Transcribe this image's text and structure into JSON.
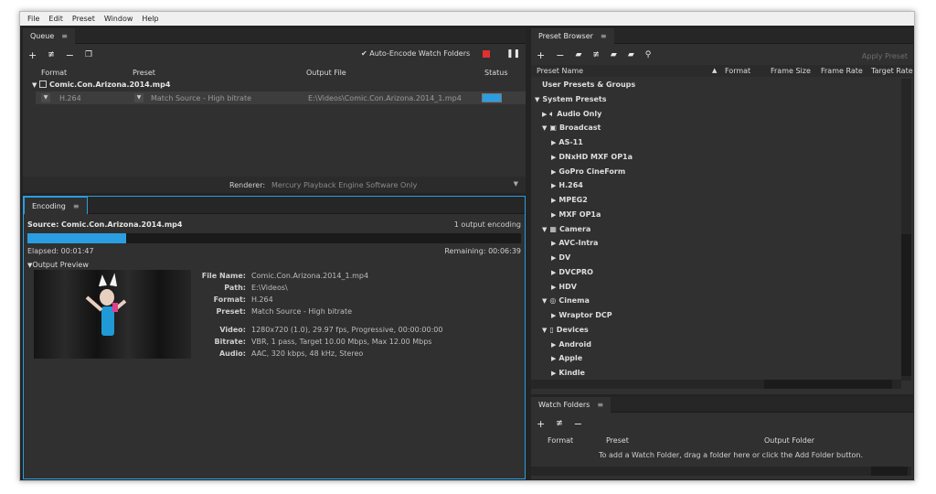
{
  "menu": [
    "File",
    "Edit",
    "Preset",
    "Window",
    "Help"
  ],
  "queue": {
    "tab": "Queue",
    "auto_encode": "Auto-Encode Watch Folders",
    "columns": {
      "format": "Format",
      "preset": "Preset",
      "output": "Output File",
      "status": "Status"
    },
    "item_name": "Comic.Con.Arizona.2014.mp4",
    "row": {
      "format": "H.264",
      "preset": "Match Source - High bitrate",
      "output": "E:\\Videos\\Comic.Con.Arizona.2014_1.mp4"
    },
    "renderer_label": "Renderer:",
    "renderer_value": "Mercury Playback Engine Software Only",
    "status_progress": 1.0
  },
  "encoding": {
    "tab": "Encoding",
    "source": "Source: Comic.Con.Arizona.2014.mp4",
    "count": "1 output encoding",
    "elapsed": "Elapsed: 00:01:47",
    "remaining": "Remaining: 00:06:39",
    "progress": 0.2,
    "output_preview": "Output Preview",
    "info": [
      {
        "label": "File Name:",
        "value": "Comic.Con.Arizona.2014_1.mp4"
      },
      {
        "label": "Path:",
        "value": "E:\\Videos\\"
      },
      {
        "label": "Format:",
        "value": "H.264"
      },
      {
        "label": "Preset:",
        "value": "Match Source - High bitrate"
      },
      {
        "label": "Video:",
        "value": "1280x720 (1.0), 29.97 fps, Progressive, 00:00:00:00"
      },
      {
        "label": "Bitrate:",
        "value": "VBR, 1 pass, Target 10.00 Mbps, Max 12.00 Mbps"
      },
      {
        "label": "Audio:",
        "value": "AAC, 320 kbps, 48 kHz, Stereo"
      }
    ]
  },
  "preset_browser": {
    "tab": "Preset Browser",
    "apply": "Apply Preset",
    "columns": {
      "name": "Preset Name",
      "format": "Format",
      "frame_size": "Frame Size",
      "frame_rate": "Frame Rate",
      "target_rate": "Target Rate"
    },
    "tree": [
      {
        "label": "User Presets & Groups",
        "level": 0,
        "arrow": "",
        "icon": ""
      },
      {
        "label": "System Presets",
        "level": 0,
        "arrow": "down",
        "icon": ""
      },
      {
        "label": "Audio Only",
        "level": 1,
        "arrow": "right",
        "icon": "speaker-icon"
      },
      {
        "label": "Broadcast",
        "level": 1,
        "arrow": "down",
        "icon": "tv-icon"
      },
      {
        "label": "AS-11",
        "level": 2,
        "arrow": "right",
        "icon": ""
      },
      {
        "label": "DNxHD MXF OP1a",
        "level": 2,
        "arrow": "right",
        "icon": ""
      },
      {
        "label": "GoPro CineForm",
        "level": 2,
        "arrow": "right",
        "icon": ""
      },
      {
        "label": "H.264",
        "level": 2,
        "arrow": "right",
        "icon": ""
      },
      {
        "label": "MPEG2",
        "level": 2,
        "arrow": "right",
        "icon": ""
      },
      {
        "label": "MXF OP1a",
        "level": 2,
        "arrow": "right",
        "icon": ""
      },
      {
        "label": "Camera",
        "level": 1,
        "arrow": "down",
        "icon": "camera-icon"
      },
      {
        "label": "AVC-Intra",
        "level": 2,
        "arrow": "right",
        "icon": ""
      },
      {
        "label": "DV",
        "level": 2,
        "arrow": "right",
        "icon": ""
      },
      {
        "label": "DVCPRO",
        "level": 2,
        "arrow": "right",
        "icon": ""
      },
      {
        "label": "HDV",
        "level": 2,
        "arrow": "right",
        "icon": ""
      },
      {
        "label": "Cinema",
        "level": 1,
        "arrow": "down",
        "icon": "film-reel-icon"
      },
      {
        "label": "Wraptor DCP",
        "level": 2,
        "arrow": "right",
        "icon": ""
      },
      {
        "label": "Devices",
        "level": 1,
        "arrow": "down",
        "icon": "phone-icon"
      },
      {
        "label": "Android",
        "level": 2,
        "arrow": "right",
        "icon": ""
      },
      {
        "label": "Apple",
        "level": 2,
        "arrow": "right",
        "icon": ""
      },
      {
        "label": "Kindle",
        "level": 2,
        "arrow": "right",
        "icon": ""
      }
    ]
  },
  "watch_folders": {
    "tab": "Watch Folders",
    "columns": {
      "format": "Format",
      "preset": "Preset",
      "output": "Output Folder"
    },
    "hint": "To add a Watch Folder, drag a folder here or click the Add Folder button."
  },
  "colors": {
    "accent": "#2a9ee0",
    "panel": "#303030",
    "bg": "#232323",
    "stop": "#e03030"
  }
}
